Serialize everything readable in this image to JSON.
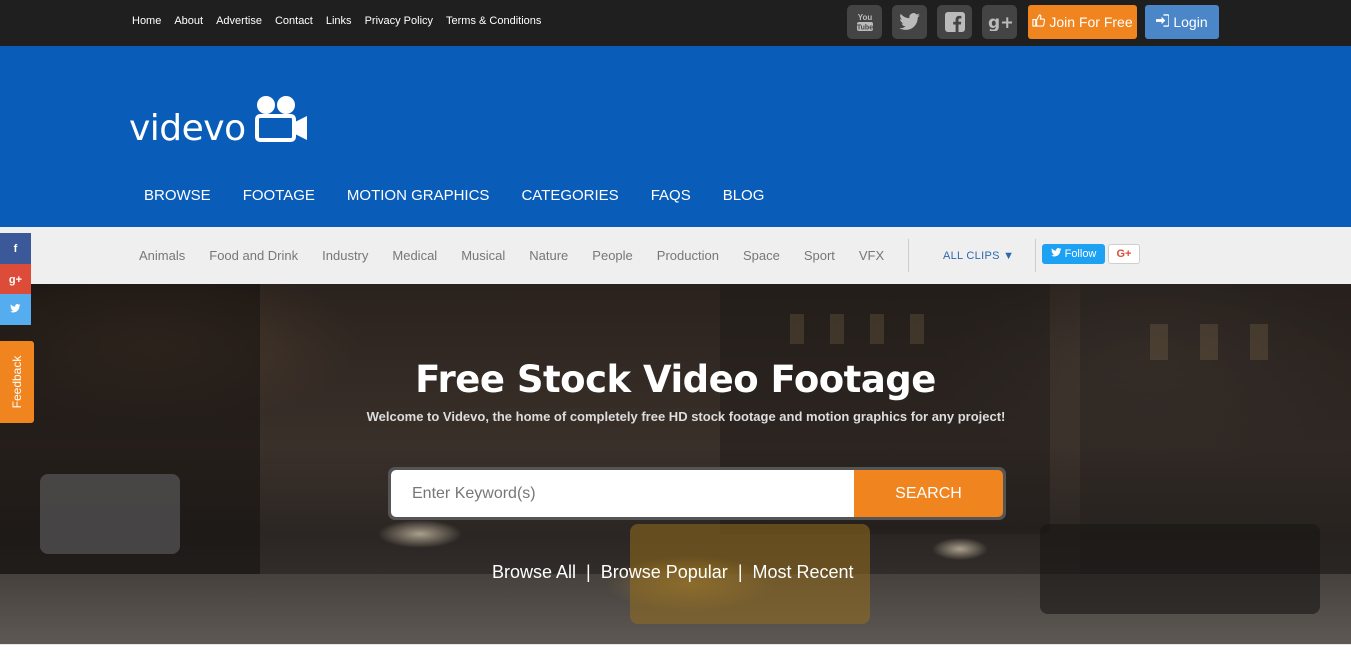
{
  "topbar": {
    "links": [
      "Home",
      "About",
      "Advertise",
      "Contact",
      "Links",
      "Privacy Policy",
      "Terms & Conditions"
    ],
    "join_label": "Join For Free",
    "login_label": "Login"
  },
  "header": {
    "logo_text": "videvo",
    "nav": [
      "BROWSE",
      "FOOTAGE",
      "MOTION GRAPHICS",
      "CATEGORIES",
      "FAQS",
      "BLOG"
    ]
  },
  "categories": {
    "items": [
      "Animals",
      "Food and Drink",
      "Industry",
      "Medical",
      "Musical",
      "Nature",
      "People",
      "Production",
      "Space",
      "Sport",
      "VFX"
    ],
    "all_clips": "ALL CLIPS ▼",
    "follow_label": "Follow",
    "gplus_label": "G+"
  },
  "hero": {
    "title": "Free Stock Video Footage",
    "subtitle": "Welcome to Videvo, the home of completely free HD stock footage and motion graphics for any project!",
    "search_placeholder": "Enter Keyword(s)",
    "search_button": "SEARCH",
    "links": [
      "Browse All",
      "Browse Popular",
      "Most Recent"
    ],
    "link_separator": "|"
  },
  "side": {
    "facebook": "f",
    "gplus": "g+",
    "feedback": "Feedback"
  },
  "colors": {
    "brand_blue": "#0a5cb9",
    "accent_orange": "#f0851f",
    "login_blue": "#4a86c8",
    "topbar": "#1f1f1f"
  }
}
